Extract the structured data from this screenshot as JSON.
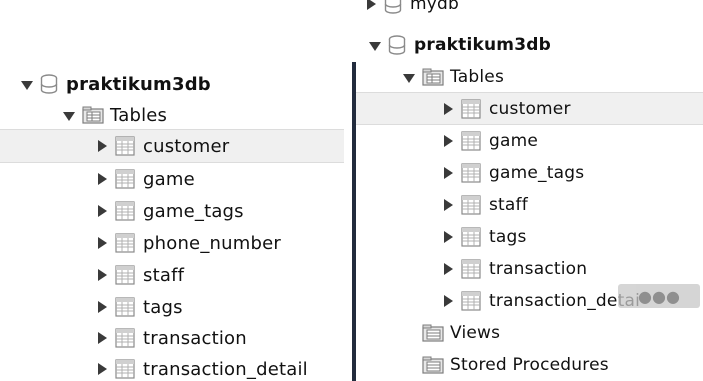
{
  "left": {
    "database": "praktikum3db",
    "tables_label": "Tables",
    "tables": [
      "customer",
      "game",
      "game_tags",
      "phone_number",
      "staff",
      "tags",
      "transaction",
      "transaction_detail"
    ]
  },
  "right": {
    "partial_db": "mydb",
    "database": "praktikum3db",
    "tables_label": "Tables",
    "tables": [
      "customer",
      "game",
      "game_tags",
      "staff",
      "tags",
      "transaction",
      "transaction_detai"
    ],
    "views_label": "Views",
    "procedures_label": "Stored Procedures"
  },
  "colors": {
    "selection": "#f0f0f0",
    "divider": "#222b3d",
    "icon_gray": "#8a8a8a"
  },
  "icons": {
    "database": "database-icon",
    "folder": "tables-folder-icon",
    "table": "table-icon",
    "expand": "triangle-right-icon",
    "collapse": "triangle-down-icon"
  }
}
